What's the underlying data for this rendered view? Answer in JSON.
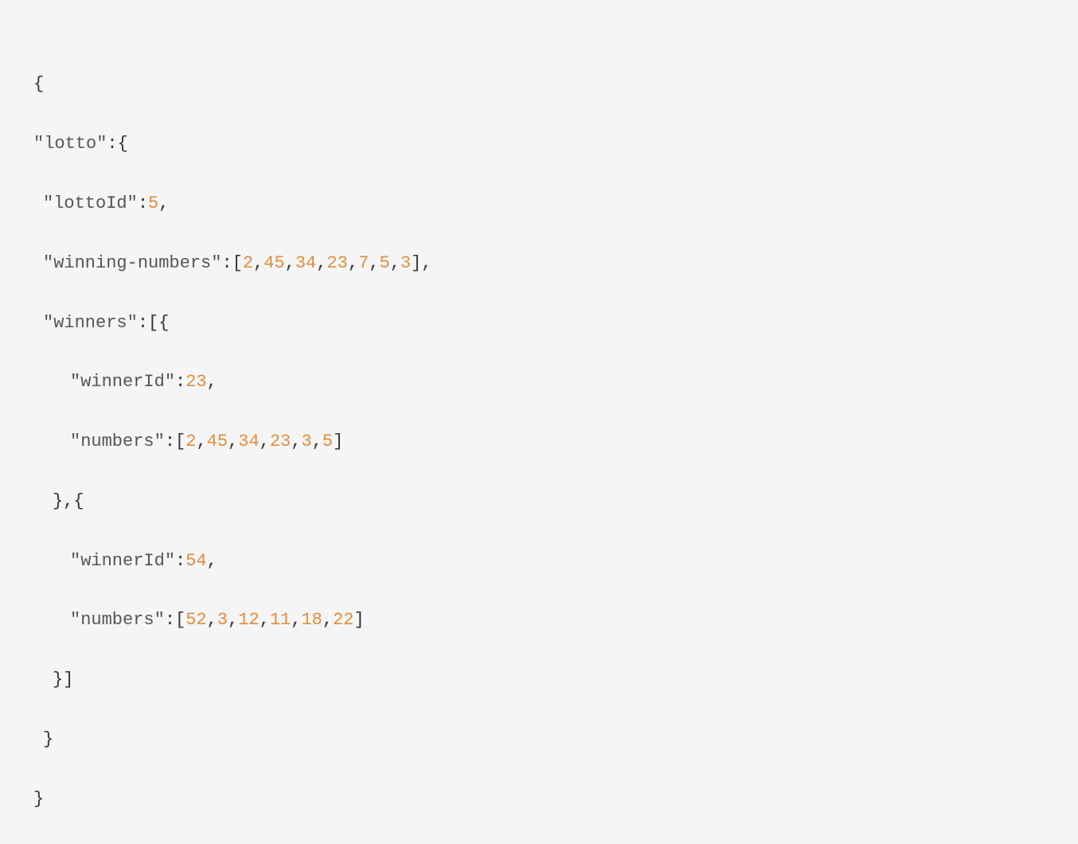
{
  "code": {
    "line1": "{",
    "line2_key": "\"lotto\"",
    "line2_punct": ":{",
    "line3_key": "\"lottoId\"",
    "line3_colon": ":",
    "line3_val": "5",
    "line3_comma": ",",
    "line4_key": "\"winning-numbers\"",
    "line4_open": ":[",
    "line4_n1": "2",
    "line4_n2": "45",
    "line4_n3": "34",
    "line4_n4": "23",
    "line4_n5": "7",
    "line4_n6": "5",
    "line4_n7": "3",
    "line4_close": "],",
    "line5_key": "\"winners\"",
    "line5_punct": ":[{",
    "line6_key": "\"winnerId\"",
    "line6_colon": ":",
    "line6_val": "23",
    "line6_comma": ",",
    "line7_key": "\"numbers\"",
    "line7_open": ":[",
    "line7_n1": "2",
    "line7_n2": "45",
    "line7_n3": "34",
    "line7_n4": "23",
    "line7_n5": "3",
    "line7_n6": "5",
    "line7_close": "]",
    "line8": "},{",
    "line9_key": "\"winnerId\"",
    "line9_colon": ":",
    "line9_val": "54",
    "line9_comma": ",",
    "line10_key": "\"numbers\"",
    "line10_open": ":[",
    "line10_n1": "52",
    "line10_n2": "3",
    "line10_n3": "12",
    "line10_n4": "11",
    "line10_n5": "18",
    "line10_n6": "22",
    "line10_close": "]",
    "line11": "}]",
    "line12": "}",
    "line13": "}",
    "comma": ","
  }
}
